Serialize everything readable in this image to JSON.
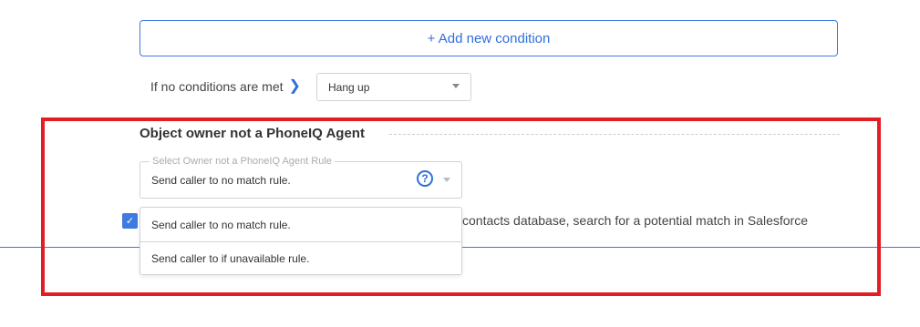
{
  "conditions": {
    "add_button_label": "+ Add new condition",
    "no_conditions_label": "If no conditions are met",
    "no_conditions_select_value": "Hang up"
  },
  "owner_section": {
    "title": "Object owner not a PhoneIQ Agent",
    "rule_field_legend": "Select Owner not a PhoneIQ Agent Rule",
    "rule_field_value": "Send caller to no match rule.",
    "help_glyph": "?",
    "dropdown_options": [
      "Send caller to no match rule.",
      "Send caller to if unavailable rule."
    ]
  },
  "search_option": {
    "checked": true,
    "visible_text": "contacts database, search for a potential match in Salesforce"
  },
  "colors": {
    "accent": "#3f7ae0",
    "highlight_border": "#e21e24",
    "field_border": "#cfd3d8"
  }
}
